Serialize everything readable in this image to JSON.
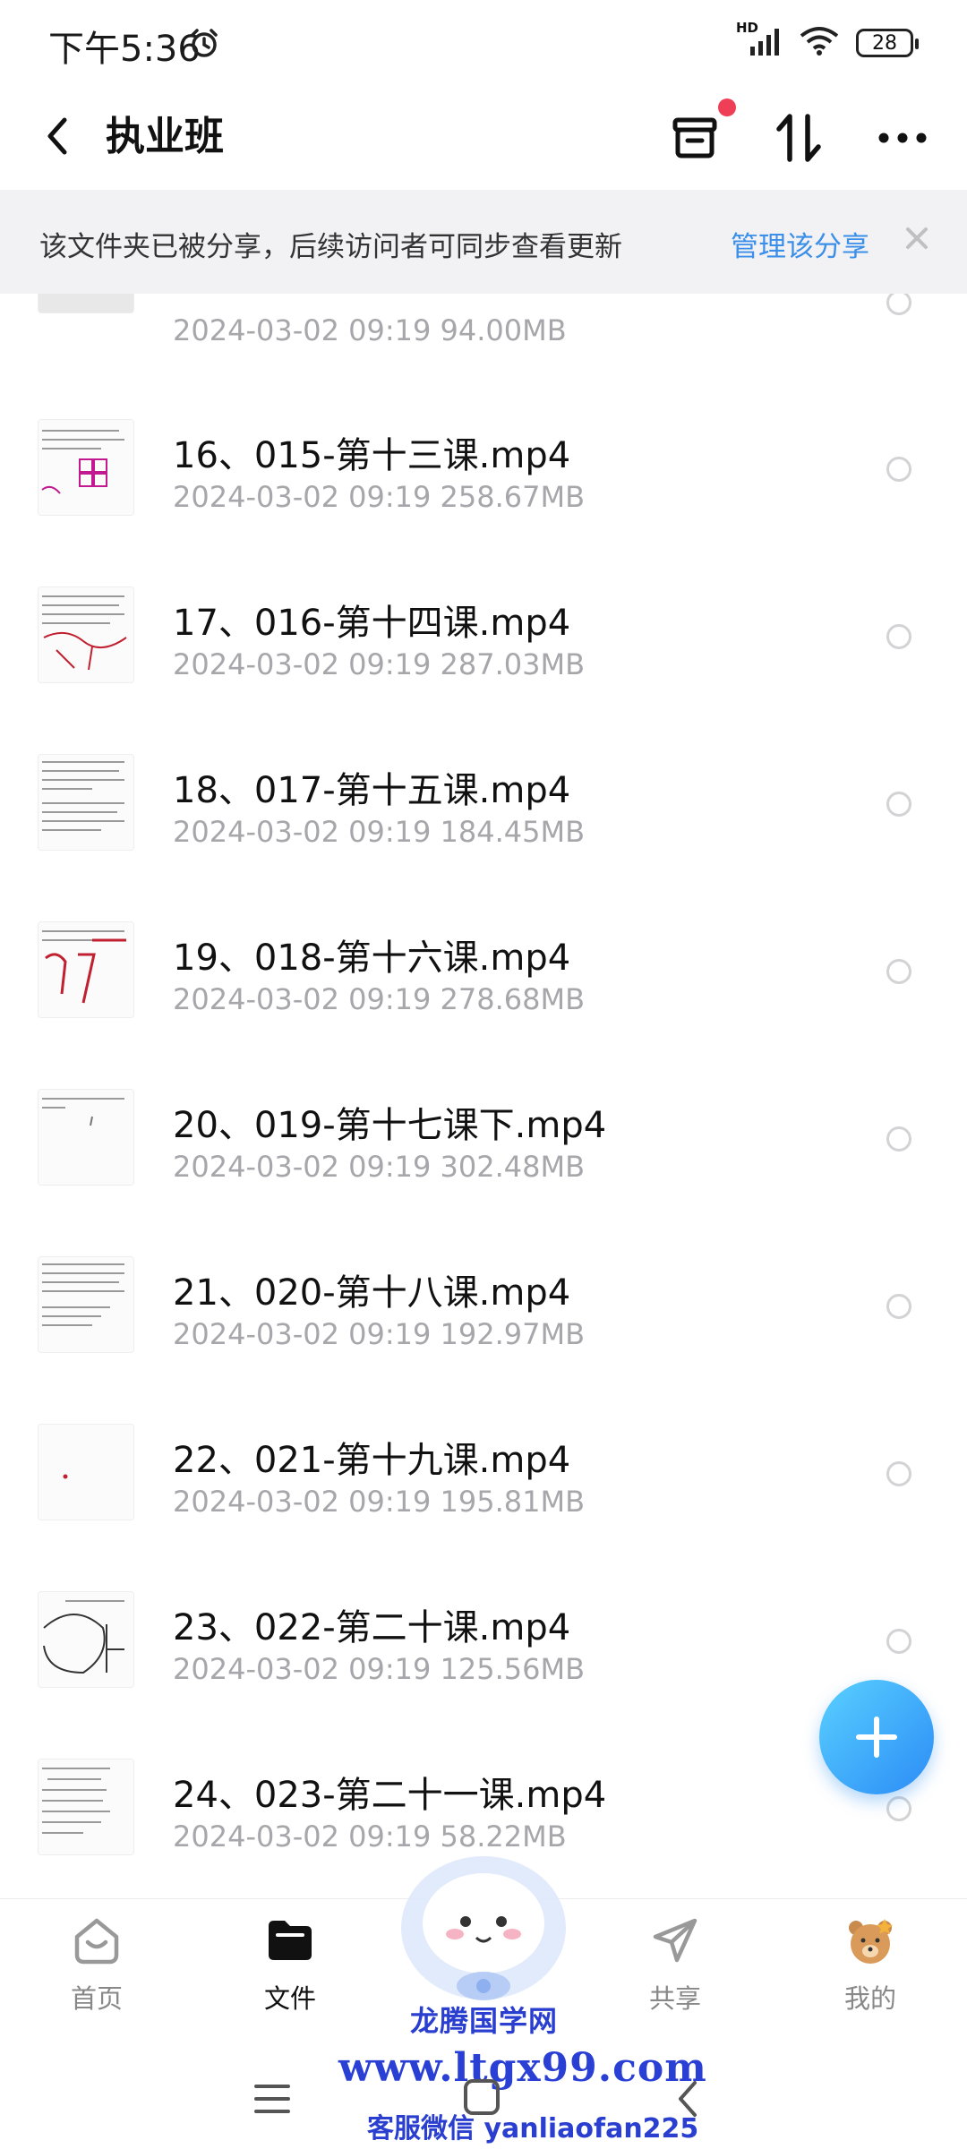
{
  "status": {
    "time": "下午5:36",
    "network": "HD",
    "battery": "28"
  },
  "header": {
    "title": "执业班"
  },
  "banner": {
    "text": "该文件夹已被分享，后续访问者可同步查看更新",
    "link": "管理该分享"
  },
  "partial_row": {
    "meta": "2024-03-02  09:19  94.00MB"
  },
  "files": [
    {
      "name": "16、015-第十三课.mp4",
      "meta": "2024-03-02  09:19  258.67MB"
    },
    {
      "name": "17、016-第十四课.mp4",
      "meta": "2024-03-02  09:19  287.03MB"
    },
    {
      "name": "18、017-第十五课.mp4",
      "meta": "2024-03-02  09:19  184.45MB"
    },
    {
      "name": "19、018-第十六课.mp4",
      "meta": "2024-03-02  09:19  278.68MB"
    },
    {
      "name": "20、019-第十七课下.mp4",
      "meta": "2024-03-02  09:19  302.48MB"
    },
    {
      "name": "21、020-第十八课.mp4",
      "meta": "2024-03-02  09:19  192.97MB"
    },
    {
      "name": "22、021-第十九课.mp4",
      "meta": "2024-03-02  09:19  195.81MB"
    },
    {
      "name": "23、022-第二十课.mp4",
      "meta": "2024-03-02  09:19  125.56MB"
    },
    {
      "name": "24、023-第二十一课.mp4",
      "meta": "2024-03-02  09:19  58.22MB"
    }
  ],
  "tabs": [
    {
      "label": "首页",
      "icon": "home-icon"
    },
    {
      "label": "文件",
      "icon": "folder-icon",
      "active": true
    },
    {
      "label": "共享",
      "icon": "share-icon"
    },
    {
      "label": "我的",
      "icon": "bear-avatar-icon"
    }
  ],
  "watermark": {
    "line1": "龙腾国学网",
    "line2": "www.ltgx99.com",
    "line3": "客服微信 yanliaofan225"
  },
  "colors": {
    "accent": "#3b8fe8",
    "badge": "#ef3f56",
    "meta": "#a7a7ab",
    "watermark": "#2a3fcf"
  }
}
